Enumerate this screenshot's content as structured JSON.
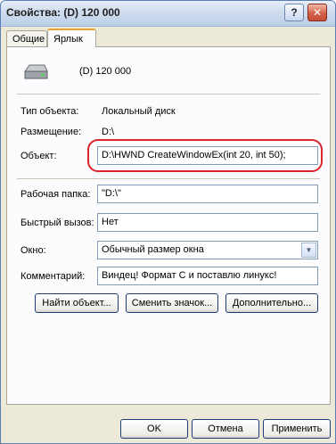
{
  "window": {
    "title": "Свойства: (D) 120 000",
    "help_label": "?",
    "close_label": "✕"
  },
  "tabs": [
    {
      "label": "Общие"
    },
    {
      "label": "Ярлык"
    }
  ],
  "header": {
    "name": "(D) 120 000",
    "icon": "drive-icon"
  },
  "fields": {
    "object_type_label": "Тип объекта:",
    "object_type_value": "Локальный диск",
    "location_label": "Размещение:",
    "location_value": "D:\\",
    "target_label": "Объект:",
    "target_value": "D:\\HWND CreateWindowEx(int 20, int 50);",
    "start_in_label": "Рабочая папка:",
    "start_in_value": "\"D:\\\"",
    "hotkey_label": "Быстрый вызов:",
    "hotkey_value": "Нет",
    "run_label": "Окно:",
    "run_value": "Обычный размер окна",
    "comment_label": "Комментарий:",
    "comment_value": "Виндец! Формат С и поставлю линукс!"
  },
  "panel_buttons": {
    "find_target": "Найти объект...",
    "change_icon": "Сменить значок...",
    "advanced": "Дополнительно..."
  },
  "dialog_buttons": {
    "ok": "OK",
    "cancel": "Отмена",
    "apply": "Применить"
  },
  "colors": {
    "highlight": "#d8262a",
    "tab_accent": "#e6a43a"
  }
}
